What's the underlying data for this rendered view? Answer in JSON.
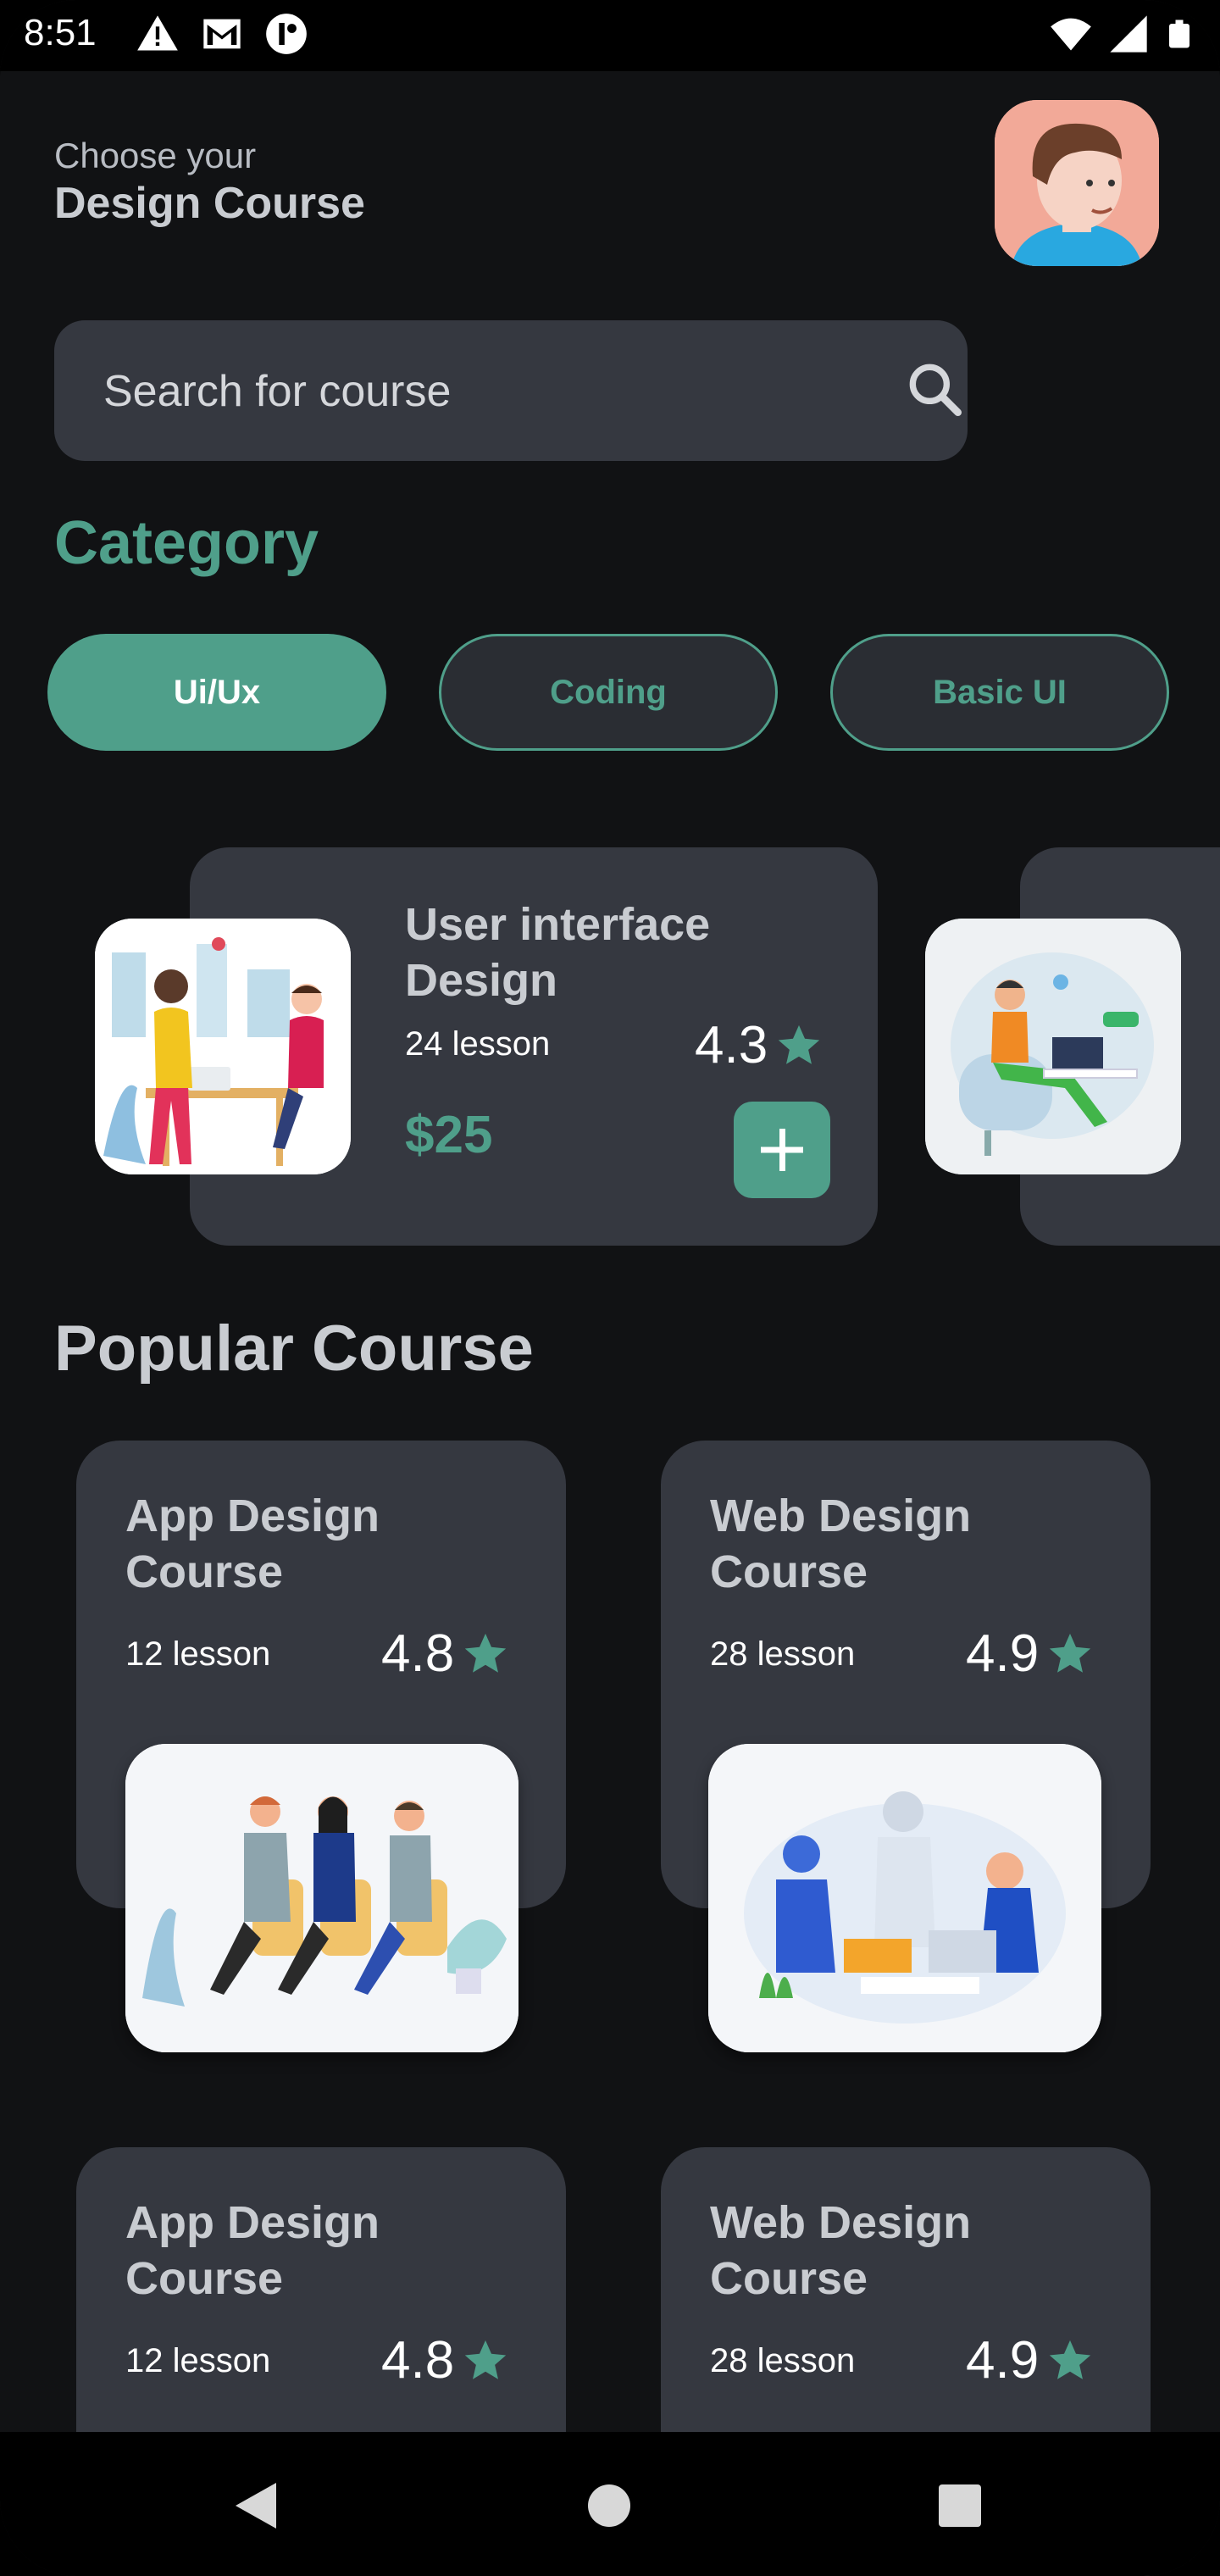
{
  "status_bar": {
    "time": "8:51"
  },
  "header": {
    "greeting": "Choose your",
    "title": "Design Course"
  },
  "search": {
    "placeholder": "Search for course"
  },
  "category": {
    "title": "Category",
    "chips": [
      {
        "label": "Ui/Ux",
        "active": true
      },
      {
        "label": "Coding",
        "active": false
      },
      {
        "label": "Basic UI",
        "active": false
      }
    ]
  },
  "featured": {
    "title": "User interface Design",
    "lessons": "24 lesson",
    "rating": "4.3",
    "price": "$25"
  },
  "popular": {
    "title": "Popular Course",
    "courses": [
      {
        "title": "App Design Course",
        "lessons": "12 lesson",
        "rating": "4.8"
      },
      {
        "title": "Web Design Course",
        "lessons": "28 lesson",
        "rating": "4.9"
      },
      {
        "title": "App Design Course",
        "lessons": "12 lesson",
        "rating": "4.8"
      },
      {
        "title": "Web Design Course",
        "lessons": "28 lesson",
        "rating": "4.9"
      }
    ]
  },
  "colors": {
    "accent": "#4f9f8a",
    "card": "#353840",
    "background": "#111214"
  },
  "icons": [
    "warning-icon",
    "gmail-icon",
    "notification-icon",
    "wifi-icon",
    "signal-icon",
    "battery-icon",
    "search-icon",
    "star-icon",
    "plus-icon",
    "back-icon",
    "home-icon",
    "recents-icon"
  ]
}
